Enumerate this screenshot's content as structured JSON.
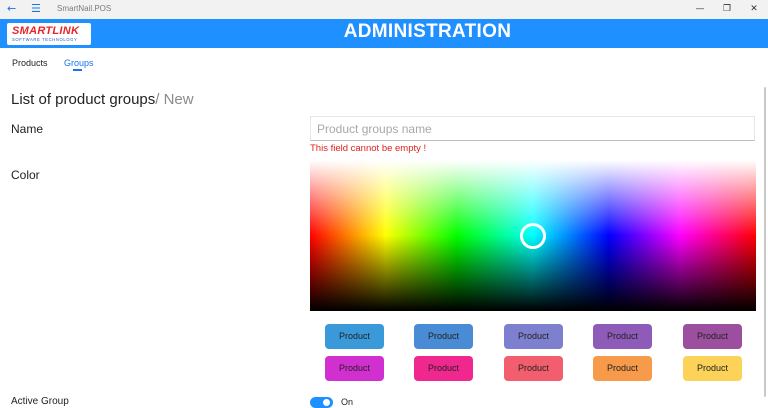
{
  "app": {
    "title": "SmartNail.POS"
  },
  "window": {
    "minimize": "—",
    "restore": "❐",
    "close": "✕"
  },
  "logo": {
    "name": "SMARTLINK",
    "tagline": "SOFTWARE TECHNOLOGY"
  },
  "header": {
    "title": "ADMINISTRATION"
  },
  "tabs": [
    {
      "label": "Products",
      "active": false
    },
    {
      "label": "Groups",
      "active": true
    }
  ],
  "heading": {
    "title": "List of product groups",
    "suffix": "/ New"
  },
  "form": {
    "name_label": "Name",
    "name_placeholder": "Product groups name",
    "name_value": "",
    "name_error": "This field cannot be empty !",
    "color_label": "Color",
    "active_label": "Active Group",
    "active_state": "On"
  },
  "swatches": [
    {
      "label": "Product",
      "color": "#3a9ad9"
    },
    {
      "label": "Product",
      "color": "#4a8bd6"
    },
    {
      "label": "Product",
      "color": "#7d7fcf"
    },
    {
      "label": "Product",
      "color": "#8e5bb8"
    },
    {
      "label": "Product",
      "color": "#9b4f9e"
    },
    {
      "label": "Product",
      "color": "#d12fd0"
    },
    {
      "label": "Product",
      "color": "#f0278f"
    },
    {
      "label": "Product",
      "color": "#f25e6e"
    },
    {
      "label": "Product",
      "color": "#f79a4a"
    },
    {
      "label": "Product",
      "color": "#fcd259"
    }
  ]
}
